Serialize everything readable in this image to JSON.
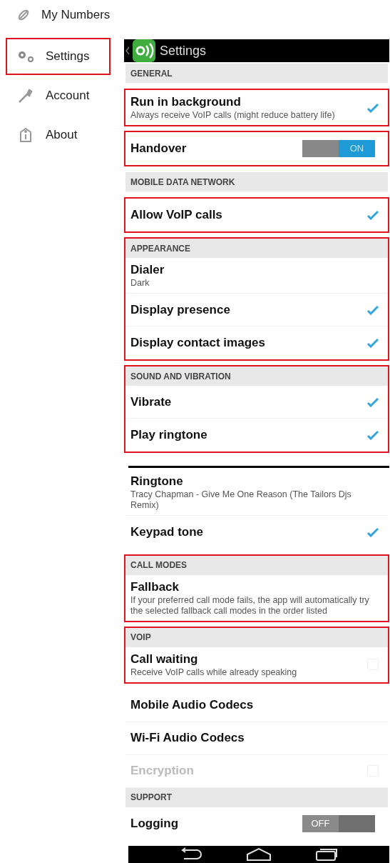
{
  "sidebar": {
    "items": [
      {
        "label": "My Numbers",
        "highlighted": false
      },
      {
        "label": "Settings",
        "highlighted": true
      },
      {
        "label": "Account",
        "highlighted": false
      },
      {
        "label": "About",
        "highlighted": false
      }
    ]
  },
  "screens": [
    {
      "title": "Settings",
      "groups": [
        {
          "highlighted": false,
          "entries": [
            {
              "kind": "header",
              "title": "GENERAL"
            }
          ]
        },
        {
          "highlighted": true,
          "entries": [
            {
              "kind": "check",
              "title": "Run in background",
              "summary": "Always receive VoIP calls (might reduce battery life)",
              "checked": true,
              "disabled": false
            }
          ]
        },
        {
          "highlighted": true,
          "entries": [
            {
              "kind": "switch",
              "title": "Handover",
              "on": true,
              "state_label": "ON"
            }
          ]
        },
        {
          "highlighted": false,
          "entries": [
            {
              "kind": "header",
              "title": "MOBILE DATA NETWORK"
            }
          ]
        },
        {
          "highlighted": true,
          "entries": [
            {
              "kind": "check",
              "title": "Allow VoIP calls",
              "checked": true,
              "disabled": false
            }
          ]
        },
        {
          "highlighted": true,
          "entries": [
            {
              "kind": "header",
              "title": "APPEARANCE"
            },
            {
              "kind": "pref",
              "title": "Dialer",
              "summary": "Dark"
            },
            {
              "kind": "check",
              "title": "Display presence",
              "checked": true,
              "disabled": false
            },
            {
              "kind": "check",
              "title": "Display contact images",
              "checked": true,
              "disabled": false
            }
          ]
        },
        {
          "highlighted": true,
          "entries": [
            {
              "kind": "header",
              "title": "SOUND AND VIBRATION"
            },
            {
              "kind": "check",
              "title": "Vibrate",
              "checked": true,
              "disabled": false
            },
            {
              "kind": "check",
              "title": "Play ringtone",
              "checked": true,
              "disabled": false
            }
          ]
        }
      ]
    },
    {
      "groups": [
        {
          "highlighted": false,
          "entries": [
            {
              "kind": "pref",
              "title": "Ringtone",
              "summary": "Tracy Chapman - Give Me One Reason (The Tailors Djs Remix)"
            },
            {
              "kind": "check",
              "title": "Keypad tone",
              "checked": true,
              "disabled": false
            }
          ]
        },
        {
          "highlighted": true,
          "entries": [
            {
              "kind": "header",
              "title": "CALL MODES"
            },
            {
              "kind": "pref",
              "title": "Fallback",
              "summary": "If your preferred call mode fails, the app will automatically try the selected fallback call modes in the order listed"
            }
          ]
        },
        {
          "highlighted": true,
          "entries": [
            {
              "kind": "header",
              "title": "VOIP"
            },
            {
              "kind": "check",
              "title": "Call waiting",
              "summary": "Receive VoIP calls while already speaking",
              "checked": false,
              "disabled": false
            }
          ]
        },
        {
          "highlighted": false,
          "entries": [
            {
              "kind": "pref",
              "title": "Mobile Audio Codecs"
            },
            {
              "kind": "pref",
              "title": "Wi-Fi Audio Codecs"
            },
            {
              "kind": "check",
              "title": "Encryption",
              "checked": false,
              "disabled": true
            },
            {
              "kind": "header",
              "title": "SUPPORT"
            },
            {
              "kind": "switch",
              "title": "Logging",
              "on": false,
              "state_label": "OFF"
            }
          ]
        }
      ]
    }
  ]
}
